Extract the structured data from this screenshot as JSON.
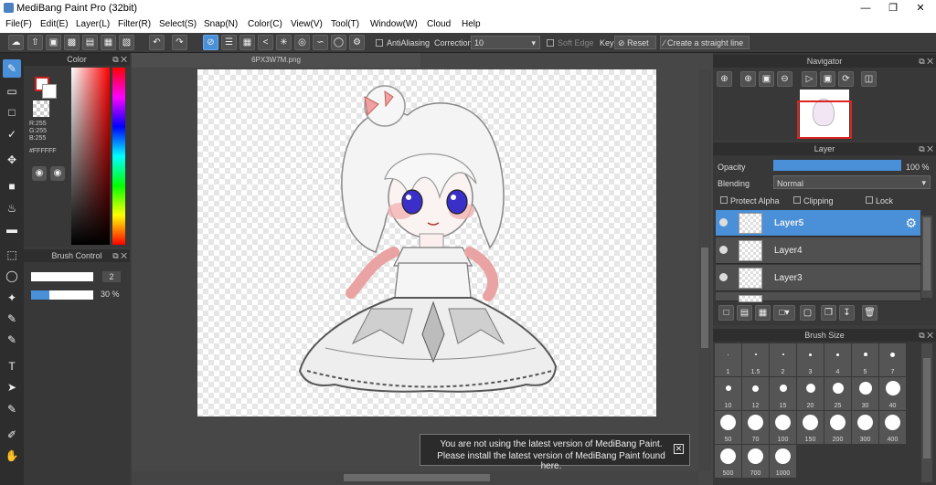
{
  "app": {
    "title": "MediBang Paint Pro (32bit)"
  },
  "menu": [
    "File(F)",
    "Edit(E)",
    "Layer(L)",
    "Filter(R)",
    "Select(S)",
    "Snap(N)",
    "Color(C)",
    "View(V)",
    "Tool(T)",
    "Window(W)",
    "Cloud",
    "Help"
  ],
  "toolbar": {
    "antialiasing_label": "AntiAliasing",
    "correction_label": "Correction",
    "correction_value": "10",
    "soft_edge_label": "Soft Edge",
    "key_label": "Key",
    "reset_label": "Reset",
    "straight_line_label": "Create a straight line"
  },
  "color_panel": {
    "title": "Color",
    "r": "R:255",
    "g": "G:255",
    "b": "B:255",
    "hex": "#FFFFFF",
    "primary_color": "#ffffff",
    "secondary_color": "#cc1f1f"
  },
  "brush_control": {
    "title": "Brush Control",
    "size_value": "2",
    "opacity_value": "30 %",
    "opacity_fraction": 0.3
  },
  "document": {
    "tab_label": "6PX3W7M.png"
  },
  "navigator": {
    "title": "Navigator"
  },
  "layer_panel": {
    "title": "Layer",
    "opacity_label": "Opacity",
    "opacity_value": "100 %",
    "opacity_fraction": 1.0,
    "blending_label": "Blending",
    "blending_value": "Normal",
    "protect_alpha_label": "Protect Alpha",
    "clipping_label": "Clipping",
    "lock_label": "Lock",
    "layers": [
      "Layer5",
      "Layer4",
      "Layer3"
    ],
    "selected_layer": "Layer5"
  },
  "brush_size": {
    "title": "Brush Size",
    "sizes": [
      "1",
      "1.5",
      "2",
      "3",
      "4",
      "5",
      "7",
      "10",
      "12",
      "15",
      "20",
      "25",
      "30",
      "40",
      "50",
      "70",
      "100",
      "150",
      "200",
      "300",
      "400",
      "500",
      "700",
      "1000"
    ]
  },
  "notice": {
    "line1": "You are not using the latest version of MediBang Paint.",
    "line2": "Please install the latest version of MediBang Paint found here."
  },
  "accent_color": "#4a90d9"
}
